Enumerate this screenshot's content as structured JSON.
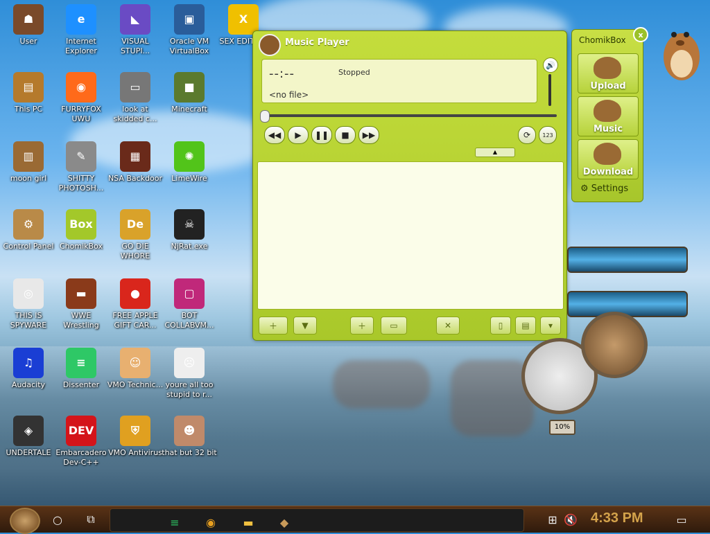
{
  "desktop": {
    "icons": [
      {
        "label": "User",
        "color": "#7a4a2a",
        "glyph": "☗"
      },
      {
        "label": "Internet Explorer",
        "color": "#1e90ff",
        "glyph": "e"
      },
      {
        "label": "VISUAL STUPI...",
        "color": "#6a4bc4",
        "glyph": "◣"
      },
      {
        "label": "Oracle VM VirtualBox",
        "color": "#2a5d9a",
        "glyph": "▣"
      },
      {
        "label": "SEX EDITO...",
        "color": "#f0c000",
        "glyph": "X"
      },
      {
        "label": "This PC",
        "color": "#b57a2c",
        "glyph": "▤"
      },
      {
        "label": "FURRYFOX UWU",
        "color": "#ff6a1a",
        "glyph": "◉"
      },
      {
        "label": "look at skidded c...",
        "color": "#777777",
        "glyph": "▭"
      },
      {
        "label": "Minecraft",
        "color": "#5b7a2e",
        "glyph": "■"
      },
      {
        "label": "moon girl",
        "color": "#9a6a34",
        "glyph": "▥"
      },
      {
        "label": "SHITTY PHOTOSH...",
        "color": "#8a8a8a",
        "glyph": "✎"
      },
      {
        "label": "NSA Backdoor",
        "color": "#6a2a1a",
        "glyph": "▦"
      },
      {
        "label": "LimeWire",
        "color": "#52c41a",
        "glyph": "✺"
      },
      {
        "label": "Control Panel",
        "color": "#b98a48",
        "glyph": "⚙"
      },
      {
        "label": "ChomikBox",
        "color": "#a3c82a",
        "glyph": "Box"
      },
      {
        "label": "GO DIE WHORE",
        "color": "#d9a22a",
        "glyph": "De"
      },
      {
        "label": "NjRat.exe",
        "color": "#222222",
        "glyph": "☠"
      },
      {
        "label": "THIS IS SPYWARE",
        "color": "#e8e8e8",
        "glyph": "◎"
      },
      {
        "label": "WWE Wrestling",
        "color": "#8a3a1a",
        "glyph": "▬"
      },
      {
        "label": "FREE APPLE GIFT CAR...",
        "color": "#d9261c",
        "glyph": "●"
      },
      {
        "label": "BOT COLLABVM...",
        "color": "#c0287a",
        "glyph": "▢"
      },
      {
        "label": "Audacity",
        "color": "#1a3ed4",
        "glyph": "♫"
      },
      {
        "label": "Dissenter",
        "color": "#2ec866",
        "glyph": "≡"
      },
      {
        "label": "VMO Technic...",
        "color": "#e8b070",
        "glyph": "☺"
      },
      {
        "label": "youre all too stupid to r...",
        "color": "#eeeeee",
        "glyph": "☹"
      },
      {
        "label": "UNDERTALE",
        "color": "#333333",
        "glyph": "◈"
      },
      {
        "label": "Embarcadero Dev-C++",
        "color": "#d4141a",
        "glyph": "DEV"
      },
      {
        "label": "VMO Antivirus",
        "color": "#e0a020",
        "glyph": "⛨"
      },
      {
        "label": "that but 32 bit",
        "color": "#c08a6a",
        "glyph": "☻"
      }
    ]
  },
  "music_player": {
    "title": "Music Player",
    "time": "--:--",
    "status": "Stopped",
    "file": "<no file>",
    "controls": {
      "rewind": "◀◀",
      "play": "▶",
      "pause": "❚❚",
      "stop": "■",
      "forward": "▶▶",
      "repeat": "⟳",
      "order": "123"
    },
    "progress": 0
  },
  "chomikbox": {
    "title": "ChomikBox",
    "close": "x",
    "upload": "Upload",
    "music": "Music",
    "download": "Download",
    "settings": "Settings"
  },
  "steam_widget": {
    "gauge_value": "10%"
  },
  "taskbar": {
    "clock": "4:33 PM"
  }
}
